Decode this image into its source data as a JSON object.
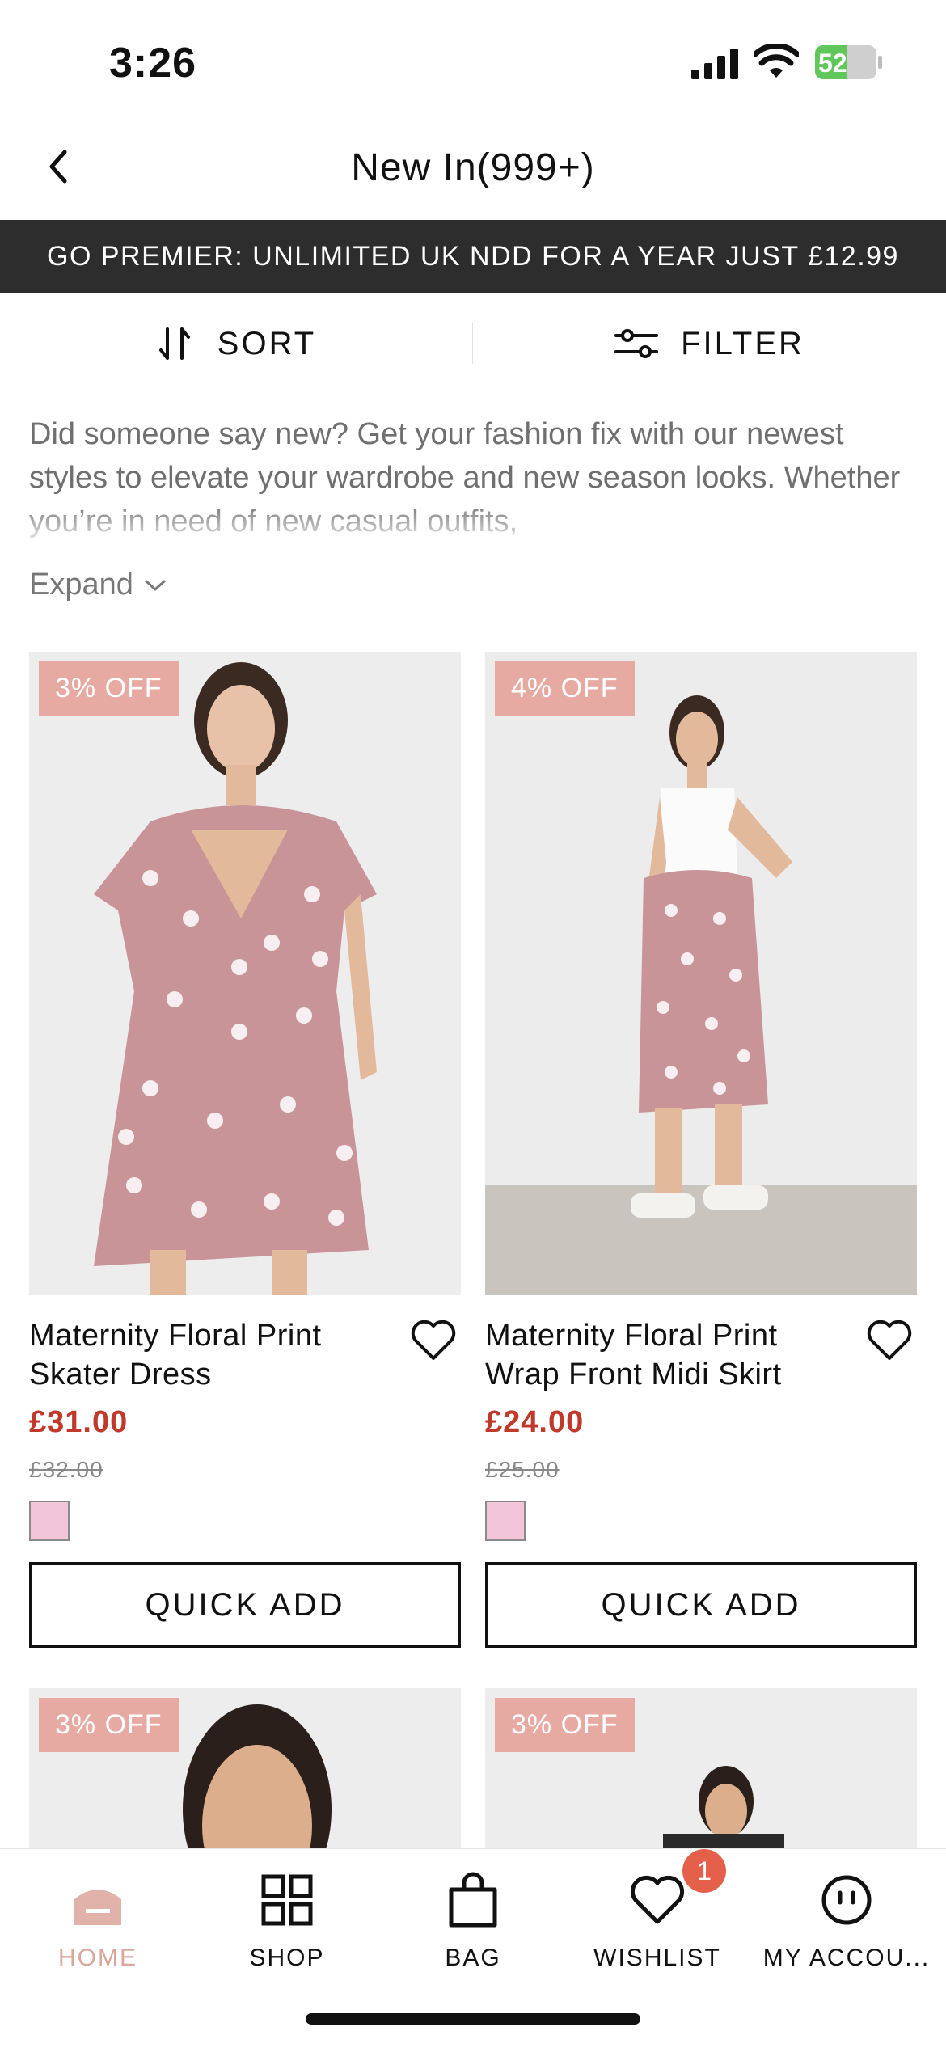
{
  "status": {
    "time": "3:26",
    "battery": "52"
  },
  "header": {
    "title": "New In(999+)"
  },
  "banner": {
    "text": "GO PREMIER: UNLIMITED UK NDD FOR A YEAR JUST £12.99"
  },
  "toolbar": {
    "sort_label": "SORT",
    "filter_label": "FILTER"
  },
  "description": {
    "text": "Did someone say new? Get your fashion fix with our newest styles to elevate your wardrobe and new season looks. Whether you’re in need of new casual outfits,",
    "expand_label": "Expand"
  },
  "products": [
    {
      "badge": "3% OFF",
      "name": "Maternity Floral Print Skater Dress",
      "price": "£31.00",
      "was": "£32.00",
      "swatch_color": "#f2c6d8",
      "quick_add": "QUICK ADD"
    },
    {
      "badge": "4% OFF",
      "name": "Maternity Floral Print Wrap Front Midi Skirt",
      "price": "£24.00",
      "was": "£25.00",
      "swatch_color": "#f2c6d8",
      "quick_add": "QUICK ADD"
    },
    {
      "badge": "3% OFF"
    },
    {
      "badge": "3% OFF"
    }
  ],
  "tabs": [
    {
      "label": "HOME",
      "icon": "home-icon",
      "active": true
    },
    {
      "label": "SHOP",
      "icon": "grid-icon"
    },
    {
      "label": "BAG",
      "icon": "bag-icon"
    },
    {
      "label": "WISHLIST",
      "icon": "heart-icon",
      "badge": "1"
    },
    {
      "label": "MY ACCOU...",
      "icon": "account-icon"
    }
  ],
  "colors": {
    "accent": "#e6aaa3",
    "sale_price": "#c0392b",
    "banner_bg": "#2d2d2d",
    "active_tab": "#d9a79c",
    "badge": "#e5604a"
  }
}
